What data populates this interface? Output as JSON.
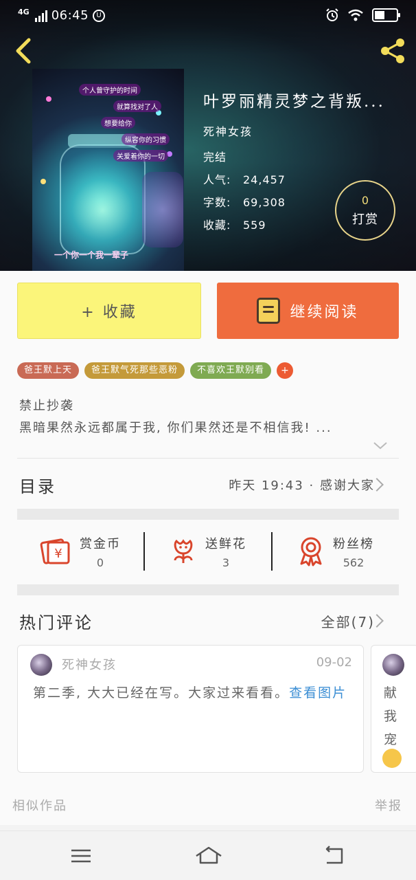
{
  "status_bar": {
    "network": "4G",
    "time": "06:45",
    "notification_badge": "U"
  },
  "book": {
    "title": "叶罗丽精灵梦之背叛...",
    "author": "死神女孩",
    "status": "完结",
    "popularity_label": "人气:",
    "popularity": "24,457",
    "wordcount_label": "字数:",
    "wordcount": "69,308",
    "favorites_label": "收藏:",
    "favorites": "559"
  },
  "cover": {
    "lines": [
      "个人曾守护的时间",
      "就算找对了人",
      "想要给你",
      "纵容你的习惯",
      "关爱着你的一切"
    ],
    "bottom_text": "一个你一个我一辈子"
  },
  "reward": {
    "count": "0",
    "label": "打赏"
  },
  "actions": {
    "collect_label": "+ 收藏",
    "read_label": "继续阅读"
  },
  "tags": [
    {
      "label": "爸王默上天",
      "color": "#c96a55"
    },
    {
      "label": "爸王默气死那些恶粉",
      "color": "#c49a3a"
    },
    {
      "label": "不喜欢王默别看",
      "color": "#7faa52"
    }
  ],
  "tag_more": "+",
  "description": {
    "line1": "禁止抄袭",
    "line2": "黑暗果然永远都属于我, 你们果然还是不相信我! ..."
  },
  "toc": {
    "title": "目录",
    "latest": "昨天 19:43 · 感谢大家"
  },
  "stats": [
    {
      "label": "赏金币",
      "value": "0",
      "icon": "yen-icon"
    },
    {
      "label": "送鲜花",
      "value": "3",
      "icon": "flower-icon"
    },
    {
      "label": "粉丝榜",
      "value": "562",
      "icon": "medal-icon"
    }
  ],
  "comments_section": {
    "title": "热门评论",
    "all_label": "全部(7)"
  },
  "comments": [
    {
      "author": "死神女孩",
      "date": "09-02",
      "text": "第二季, 大大已经在写。大家过来看看。",
      "link": "查看图片"
    },
    {
      "text": "献我宠"
    }
  ],
  "footer": {
    "similar_label": "相似作品",
    "report_label": "举报"
  },
  "colors": {
    "collect_bg": "#fbf57a",
    "read_bg": "#ef6c3e",
    "accent_gold": "#e8d48a",
    "link_blue": "#3b8ed4"
  }
}
